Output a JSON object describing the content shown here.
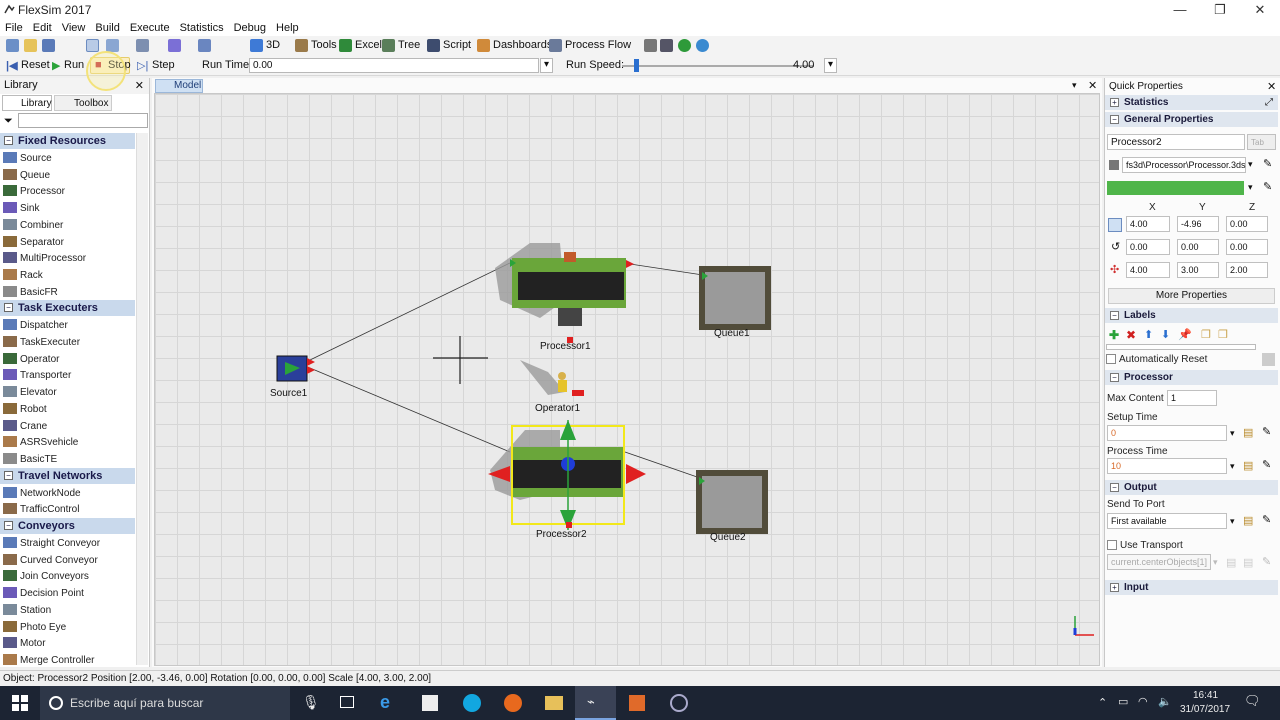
{
  "window": {
    "title": "FlexSim 2017",
    "minimize": "—",
    "maximize": "❐",
    "close": "✕"
  },
  "menu": [
    "File",
    "Edit",
    "View",
    "Build",
    "Execute",
    "Statistics",
    "Debug",
    "Help"
  ],
  "toolbar": {
    "view_3d": "3D",
    "tools": "Tools",
    "excel": "Excel",
    "tree": "Tree",
    "script": "Script",
    "dashboards": "Dashboards",
    "process_flow": "Process Flow"
  },
  "run_controls": {
    "reset": "Reset",
    "run": "Run",
    "stop": "Stop",
    "step": "Step",
    "run_time_label": "Run Time:",
    "run_time_value": "0.00",
    "run_speed_label": "Run Speed:",
    "run_speed_value": "4.00"
  },
  "library": {
    "title": "Library",
    "tabs": [
      "Library",
      "Toolbox"
    ],
    "categories": [
      {
        "name": "Fixed Resources",
        "items": [
          "Source",
          "Queue",
          "Processor",
          "Sink",
          "Combiner",
          "Separator",
          "MultiProcessor",
          "Rack",
          "BasicFR"
        ]
      },
      {
        "name": "Task Executers",
        "items": [
          "Dispatcher",
          "TaskExecuter",
          "Operator",
          "Transporter",
          "Elevator",
          "Robot",
          "Crane",
          "ASRSvehicle",
          "BasicTE"
        ]
      },
      {
        "name": "Travel Networks",
        "items": [
          "NetworkNode",
          "TrafficControl"
        ]
      },
      {
        "name": "Conveyors",
        "items": [
          "Straight Conveyor",
          "Curved Conveyor",
          "Join Conveyors",
          "Decision Point",
          "Station",
          "Photo Eye",
          "Motor",
          "Merge Controller"
        ]
      }
    ]
  },
  "model": {
    "tab": "Model",
    "objects": {
      "source1": "Source1",
      "processor1": "Processor1",
      "processor2": "Processor2",
      "queue1": "Queue1",
      "queue2": "Queue2",
      "operator1": "Operator1"
    }
  },
  "quick_properties": {
    "title": "Quick Properties",
    "statistics": "Statistics",
    "general": "General Properties",
    "name": "Processor2",
    "shape": "fs3d\\Processor\\Processor.3ds",
    "color": "#4fb54a",
    "axes": [
      "X",
      "Y",
      "Z"
    ],
    "position": [
      "4.00",
      "-4.96",
      "0.00"
    ],
    "rotation": [
      "0.00",
      "0.00",
      "0.00"
    ],
    "size": [
      "4.00",
      "3.00",
      "2.00"
    ],
    "more_properties": "More Properties",
    "labels": "Labels",
    "auto_reset": "Automatically Reset",
    "processor_section": "Processor",
    "max_content_label": "Max Content",
    "max_content": "1",
    "setup_time_label": "Setup Time",
    "setup_time": "0",
    "process_time_label": "Process Time",
    "process_time": "10",
    "output_section": "Output",
    "send_to_port_label": "Send To Port",
    "send_to_port": "First available",
    "use_transport": "Use Transport",
    "transport_value": "current.centerObjects[1]",
    "input_section": "Input"
  },
  "status": "Object: Processor2 Position [2.00, -3.46, 0.00] Rotation [0.00, 0.00, 0.00] Scale [4.00, 3.00, 2.00]",
  "taskbar": {
    "search_placeholder": "Escribe aquí para buscar",
    "time": "16:41",
    "date": "31/07/2017"
  }
}
